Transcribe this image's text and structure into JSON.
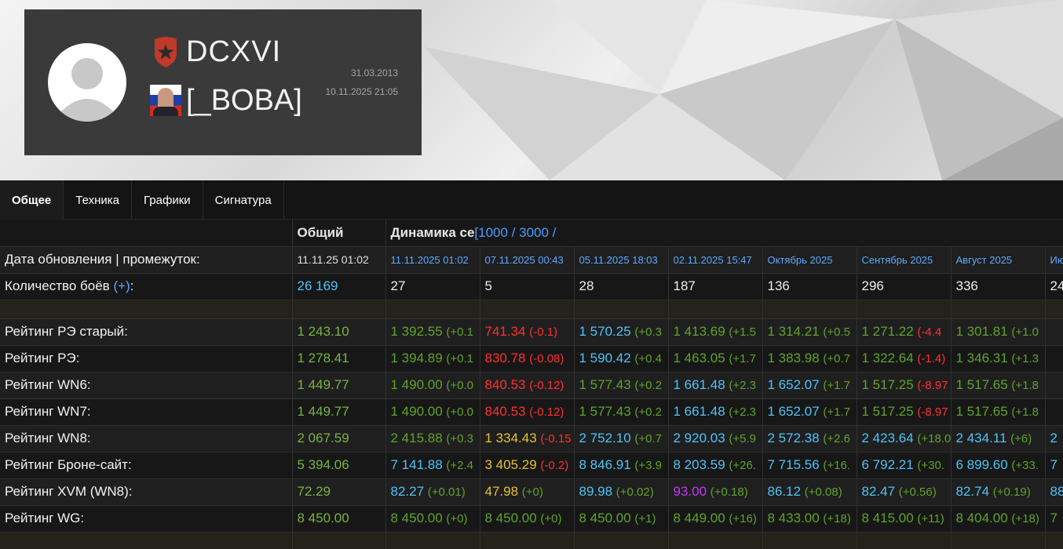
{
  "profile": {
    "clan_tag": "DCXVI",
    "player_name": "[_BOBA]",
    "registered": "31.03.2013",
    "last_battle": "10.11.2025 21:05"
  },
  "colors": {
    "green": "#5fa32b",
    "blue": "#4fc3f7",
    "red": "#ff3030",
    "yellow": "#e5c12e",
    "purple": "#c338f4",
    "link_blue": "#5fa9ff"
  },
  "icons": {
    "clan": "clan-emblem-icon",
    "avatar": "user-silhouette-icon",
    "player_flag": "player-avatar-icon"
  },
  "tabs": [
    {
      "label": "Общее",
      "active": true
    },
    {
      "label": "Техника",
      "active": false
    },
    {
      "label": "Графики",
      "active": false
    },
    {
      "label": "Сигнатура",
      "active": false
    }
  ],
  "table": {
    "header_total": "Общий",
    "dynamics_title": "Динамика се",
    "dynamics_links": "[1000 / 3000 /",
    "update_label": "Дата обновления | промежуток:",
    "update_total": "11.11.25 01:02",
    "periods": [
      "11.11.2025 01:02",
      "07.11.2025 00:43",
      "05.11.2025 18:03",
      "02.11.2025 15:47",
      "Октябрь 2025",
      "Сентябрь 2025",
      "Август 2025",
      "Ию"
    ],
    "battles_label": "Количество боёв",
    "battles_link": "(+)",
    "battles_suffix": ":",
    "battles_total": "26 169",
    "battles": [
      "27",
      "5",
      "28",
      "187",
      "136",
      "296",
      "336",
      "24"
    ],
    "rows": [
      {
        "label": "Рейтинг РЭ старый:",
        "total": "1 243.10",
        "total_c": "green2",
        "cells": [
          [
            "1 392.55",
            "(+0.1",
            "green"
          ],
          [
            "741.34",
            "(-0.1)",
            "red"
          ],
          [
            "1 570.25",
            "(+0.3",
            "blue"
          ],
          [
            "1 413.69",
            "(+1.5",
            "green"
          ],
          [
            "1 314.21",
            "(+0.5",
            "green"
          ],
          [
            "1 271.22",
            "(-4.4",
            "green"
          ],
          [
            "1 301.81",
            "(+1.0",
            "green"
          ],
          [
            "",
            "",
            ""
          ]
        ]
      },
      {
        "label": "Рейтинг РЭ:",
        "total": "1 278.41",
        "total_c": "green2",
        "cells": [
          [
            "1 394.89",
            "(+0.1",
            "green"
          ],
          [
            "830.78",
            "(-0.08)",
            "red"
          ],
          [
            "1 590.42",
            "(+0.4",
            "blue"
          ],
          [
            "1 463.05",
            "(+1.7",
            "green"
          ],
          [
            "1 383.98",
            "(+0.7",
            "green"
          ],
          [
            "1 322.64",
            "(-1.4)",
            "green"
          ],
          [
            "1 346.31",
            "(+1.3",
            "green"
          ],
          [
            "",
            "",
            ""
          ]
        ]
      },
      {
        "label": "Рейтинг WN6:",
        "total": "1 449.77",
        "total_c": "green2",
        "cells": [
          [
            "1 490.00",
            "(+0.0",
            "green"
          ],
          [
            "840.53",
            "(-0.12)",
            "red"
          ],
          [
            "1 577.43",
            "(+0.2",
            "green"
          ],
          [
            "1 661.48",
            "(+2.3",
            "blue"
          ],
          [
            "1 652.07",
            "(+1.7",
            "blue"
          ],
          [
            "1 517.25",
            "(-8.97",
            "green"
          ],
          [
            "1 517.65",
            "(+1.8",
            "green"
          ],
          [
            "",
            "",
            ""
          ]
        ]
      },
      {
        "label": "Рейтинг WN7:",
        "total": "1 449.77",
        "total_c": "green2",
        "cells": [
          [
            "1 490.00",
            "(+0.0",
            "green"
          ],
          [
            "840.53",
            "(-0.12)",
            "red"
          ],
          [
            "1 577.43",
            "(+0.2",
            "green"
          ],
          [
            "1 661.48",
            "(+2.3",
            "blue"
          ],
          [
            "1 652.07",
            "(+1.7",
            "blue"
          ],
          [
            "1 517.25",
            "(-8.97",
            "green"
          ],
          [
            "1 517.65",
            "(+1.8",
            "green"
          ],
          [
            "",
            "",
            ""
          ]
        ]
      },
      {
        "label": "Рейтинг WN8:",
        "total": "2 067.59",
        "total_c": "green2",
        "cells": [
          [
            "2 415.88",
            "(+0.3",
            "green"
          ],
          [
            "1 334.43",
            "(-0.15",
            "yellow"
          ],
          [
            "2 752.10",
            "(+0.7",
            "blue"
          ],
          [
            "2 920.03",
            "(+5.9",
            "blue"
          ],
          [
            "2 572.38",
            "(+2.6",
            "blue"
          ],
          [
            "2 423.64",
            "(+18.0",
            "blue"
          ],
          [
            "2 434.11",
            "(+6)",
            "blue"
          ],
          [
            "2",
            "",
            "blue"
          ]
        ]
      },
      {
        "label": "Рейтинг Броне-сайт:",
        "total": "5 394.06",
        "total_c": "green2",
        "cells": [
          [
            "7 141.88",
            "(+2.4",
            "blue"
          ],
          [
            "3 405.29",
            "(-0.2)",
            "yellow"
          ],
          [
            "8 846.91",
            "(+3.9",
            "blue"
          ],
          [
            "8 203.59",
            "(+26.",
            "blue"
          ],
          [
            "7 715.56",
            "(+16.",
            "blue"
          ],
          [
            "6 792.21",
            "(+30.",
            "blue"
          ],
          [
            "6 899.60",
            "(+33.",
            "blue"
          ],
          [
            "7",
            "",
            "blue"
          ]
        ]
      },
      {
        "label": "Рейтинг XVM (WN8):",
        "total": "72.29",
        "total_c": "green2",
        "cells": [
          [
            "82.27",
            "(+0.01)",
            "blue"
          ],
          [
            "47.98",
            "(+0)",
            "yellow"
          ],
          [
            "89.98",
            "(+0.02)",
            "blue"
          ],
          [
            "93.00",
            "(+0.18)",
            "purple"
          ],
          [
            "86.12",
            "(+0.08)",
            "blue"
          ],
          [
            "82.47",
            "(+0.56)",
            "blue"
          ],
          [
            "82.74",
            "(+0.19)",
            "blue"
          ],
          [
            "88",
            "",
            "blue"
          ]
        ]
      },
      {
        "label": "Рейтинг WG:",
        "total": "8 450.00",
        "total_c": "green2",
        "cells": [
          [
            "8 450.00",
            "(+0)",
            "green"
          ],
          [
            "8 450.00",
            "(+0)",
            "green"
          ],
          [
            "8 450.00",
            "(+1)",
            "green"
          ],
          [
            "8 449.00",
            "(+16)",
            "green"
          ],
          [
            "8 433.00",
            "(+18)",
            "green"
          ],
          [
            "8 415.00",
            "(+11)",
            "green"
          ],
          [
            "8 404.00",
            "(+18)",
            "green"
          ],
          [
            "7",
            "",
            "green"
          ]
        ]
      }
    ]
  }
}
